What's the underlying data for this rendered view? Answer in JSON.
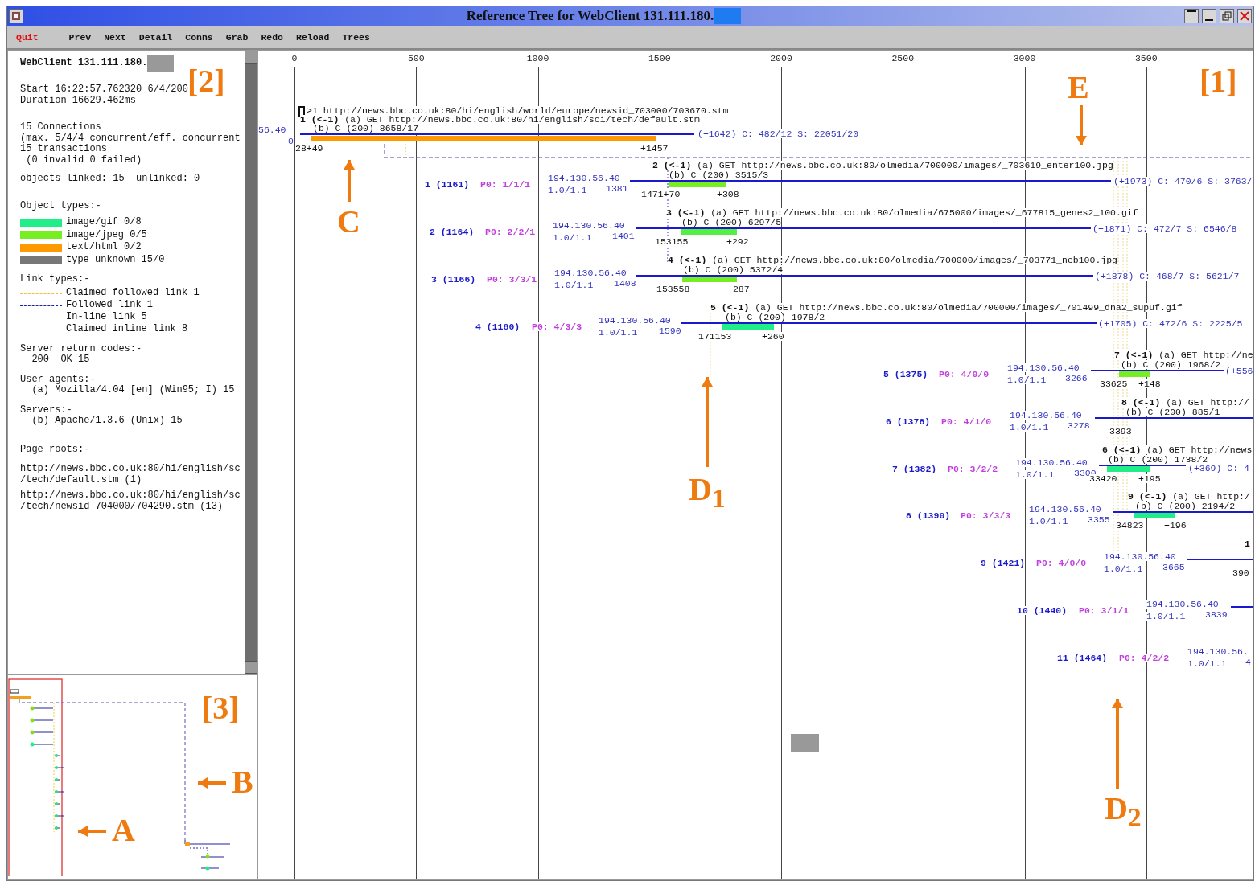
{
  "window": {
    "title": "Reference Tree for WebClient 131.111.180."
  },
  "menu": [
    {
      "label": "Quit",
      "kind": "quit"
    },
    {
      "label": "Prev",
      "kind": "item"
    },
    {
      "label": "Next",
      "kind": "item"
    },
    {
      "label": "Detail",
      "kind": "item"
    },
    {
      "label": "Conns",
      "kind": "item"
    },
    {
      "label": "Grab",
      "kind": "item"
    },
    {
      "label": "Redo",
      "kind": "item"
    },
    {
      "label": "Reload",
      "kind": "item"
    },
    {
      "label": "Trees",
      "kind": "item"
    }
  ],
  "summary": {
    "client": "WebClient 131.111.180.",
    "sections": [
      {
        "kind": "text",
        "lines": [
          "Start 16:22:57.762320 6/4/200",
          "Duration 16629.462ms"
        ]
      },
      {
        "kind": "text",
        "lines": [
          "15 Connections",
          "(max. 5/4/4 concurrent/eff. concurrent",
          "15 transactions",
          " (0 invalid 0 failed)"
        ]
      },
      {
        "kind": "text",
        "lines": [
          "objects linked: 15  unlinked: 0"
        ]
      },
      {
        "kind": "swatches",
        "title": "Object types:-",
        "items": [
          {
            "label": "image/gif 0/8",
            "color": "#22ee88"
          },
          {
            "label": "image/jpeg 0/5",
            "color": "#77ee22"
          },
          {
            "label": "text/html 0/2",
            "color": "#ff9900"
          },
          {
            "label": "type unknown 15/0",
            "color": "#777777"
          }
        ]
      },
      {
        "kind": "links",
        "title": "Link types:-",
        "items": [
          {
            "label": "Claimed followed link 1",
            "color": "#f0c040",
            "kind": "dashed"
          },
          {
            "label": "Followed link 1",
            "color": "#2222aa",
            "kind": "dashed"
          },
          {
            "label": "In-line link 5",
            "color": "#3333cc",
            "kind": "dotted"
          },
          {
            "label": "Claimed inline link 8",
            "color": "#f0c080",
            "kind": "dotted"
          }
        ]
      },
      {
        "kind": "text",
        "title": "Server return codes:-",
        "lines": [
          "  200  OK 15"
        ]
      },
      {
        "kind": "text",
        "title": "User agents:-",
        "lines": [
          "  (a) Mozilla/4.04 [en] (Win95; I) 15"
        ]
      },
      {
        "kind": "text",
        "title": "Servers:-",
        "lines": [
          "  (b) Apache/1.3.6 (Unix) 15"
        ]
      },
      {
        "kind": "roots",
        "title": "Page roots:-",
        "lines": [
          "http://news.bbc.co.uk:80/hi/english/sc\n/tech/default.stm (1)",
          "http://news.bbc.co.uk:80/hi/english/sc\n/tech/newsid_704000/704290.stm (13)"
        ]
      }
    ]
  },
  "timeline": {
    "axis": [
      "0",
      "500",
      "1000",
      "1500",
      "2000",
      "2500",
      "3000",
      "3500"
    ],
    "root": {
      "page": ">1 http://news.bbc.co.uk:80/hi/english/world/europe/newsid_703000/703670.stm",
      "request": "**1 (<-1)** (a) GET http://news.bbc.co.uk:80/hi/english/sci/tech/default.stm",
      "response": "(b) C (200) 8658/17",
      "host": "56.40",
      "start": "0",
      "times": [
        "28+49",
        "+1457"
      ],
      "summary": "(+1642) C: 482/12 S: 22051/20",
      "color": "#ff9900"
    },
    "connections": [
      {
        "label": "1 (1161)",
        "pages": "P0: 1/1/1",
        "host": "194.130.56.40",
        "version": "1.0/1.1",
        "start": "1381",
        "transaction": {
          "request": "**2 (<-1)** (a) GET http://news.bbc.co.uk:80/olmedia/700000/images/_703619_enter100.jpg",
          "response": "(b) C (200) 3515/3",
          "times": [
            "1471+70",
            "+308"
          ],
          "summary": "(+1973) C: 470/6 S: 3763/",
          "color": "#77ee22"
        }
      },
      {
        "label": "2 (1164)",
        "pages": "P0: 2/2/1",
        "host": "194.130.56.40",
        "version": "1.0/1.1",
        "start": "1401",
        "transaction": {
          "request": "**3 (<-1)** (a) GET http://news.bbc.co.uk:80/olmedia/675000/images/_677815_genes2_100.gif",
          "response": "(b) C (200) 6297/5",
          "times": [
            "153155",
            "+292"
          ],
          "summary": "(+1871) C: 472/7 S: 6546/8",
          "color": "#55ee44"
        }
      },
      {
        "label": "3 (1166)",
        "pages": "P0: 3/3/1",
        "host": "194.130.56.40",
        "version": "1.0/1.1",
        "start": "1408",
        "transaction": {
          "request": "**4 (<-1)** (a) GET http://news.bbc.co.uk:80/olmedia/700000/images/_703771_neb100.jpg",
          "response": "(b) C (200) 5372/4",
          "times": [
            "153558",
            "+287"
          ],
          "summary": "(+1878) C: 468/7 S: 5621/7",
          "color": "#77ee22"
        }
      },
      {
        "label": "4 (1180)",
        "pages": "P0: 4/3/3",
        "host": "194.130.56.40",
        "version": "1.0/1.1",
        "start": "1590",
        "transaction": {
          "request": "**5 (<-1)** (a) GET http://news.bbc.co.uk:80/olmedia/700000/images/_701499_dna2_supuf.gif",
          "response": "(b) C (200) 1978/2",
          "times": [
            "171153",
            "+260"
          ],
          "summary": "(+1705) C: 472/6 S: 2225/5",
          "color": "#22ee88"
        }
      },
      {
        "label": "5 (1375)",
        "pages": "P0: 4/0/0",
        "host": "194.130.56.40",
        "version": "1.0/1.1",
        "start": "3266",
        "transaction": {
          "request": "**7 (<-1)** (a) GET http://ne",
          "response": "(b) C (200) 1968/2",
          "times": [
            "33625",
            "+148"
          ],
          "summary": "(+556",
          "color": "#77ee22"
        }
      },
      {
        "label": "6 (1378)",
        "pages": "P0: 4/1/0",
        "host": "194.130.56.40",
        "version": "1.0/1.1",
        "start": "3278",
        "transaction": {
          "request": "**8 (<-1)** (a) GET http://",
          "response": "(b) C (200) 885/1",
          "times": [
            "3393"
          ]
        }
      },
      {
        "label": "7 (1382)",
        "pages": "P0: 3/2/2",
        "host": "194.130.56.40",
        "version": "1.0/1.1",
        "start": "3300",
        "transaction": {
          "request": "**6 (<-1)** (a) GET http://news",
          "response": "(b) C (200) 1738/2",
          "times": [
            "33420",
            "+195"
          ],
          "summary": "(+369) C: 4",
          "color": "#22ee88"
        }
      },
      {
        "label": "8 (1390)",
        "pages": "P0: 3/3/3",
        "host": "194.130.56.40",
        "version": "1.0/1.1",
        "start": "3355",
        "transaction": {
          "request": "**9 (<-1)** (a) GET http:/",
          "response": "(b) C (200) 2194/2",
          "times": [
            "34823",
            "+196"
          ],
          "color": "#22ee88"
        }
      },
      {
        "label": "9 (1421)",
        "pages": "P0: 4/0/0",
        "host": "194.130.56.40",
        "version": "1.0/1.1",
        "start": "3665",
        "transaction": {
          "request": "**1**",
          "times": [
            "390"
          ]
        }
      },
      {
        "label": "10 (1440)",
        "pages": "P0: 3/1/1",
        "host": "194.130.56.40",
        "version": "1.0/1.1",
        "start": "3839"
      },
      {
        "label": "11 (1464)",
        "pages": "P0: 4/2/2",
        "host": "194.130.56.",
        "version": "1.0/1.1",
        "start": "4"
      }
    ]
  },
  "annotations": [
    {
      "text": "[2]",
      "kind": "label"
    },
    {
      "text": "E",
      "kind": "down"
    },
    {
      "text": "[1]",
      "kind": "label"
    },
    {
      "text": "C",
      "kind": "up"
    },
    {
      "text": "D$_{1}$",
      "kind": "up"
    },
    {
      "text": "[3]",
      "kind": "label"
    },
    {
      "text": "B",
      "kind": "left"
    },
    {
      "text": "D$_{2}$",
      "kind": "up"
    },
    {
      "text": "A",
      "kind": "left"
    }
  ]
}
